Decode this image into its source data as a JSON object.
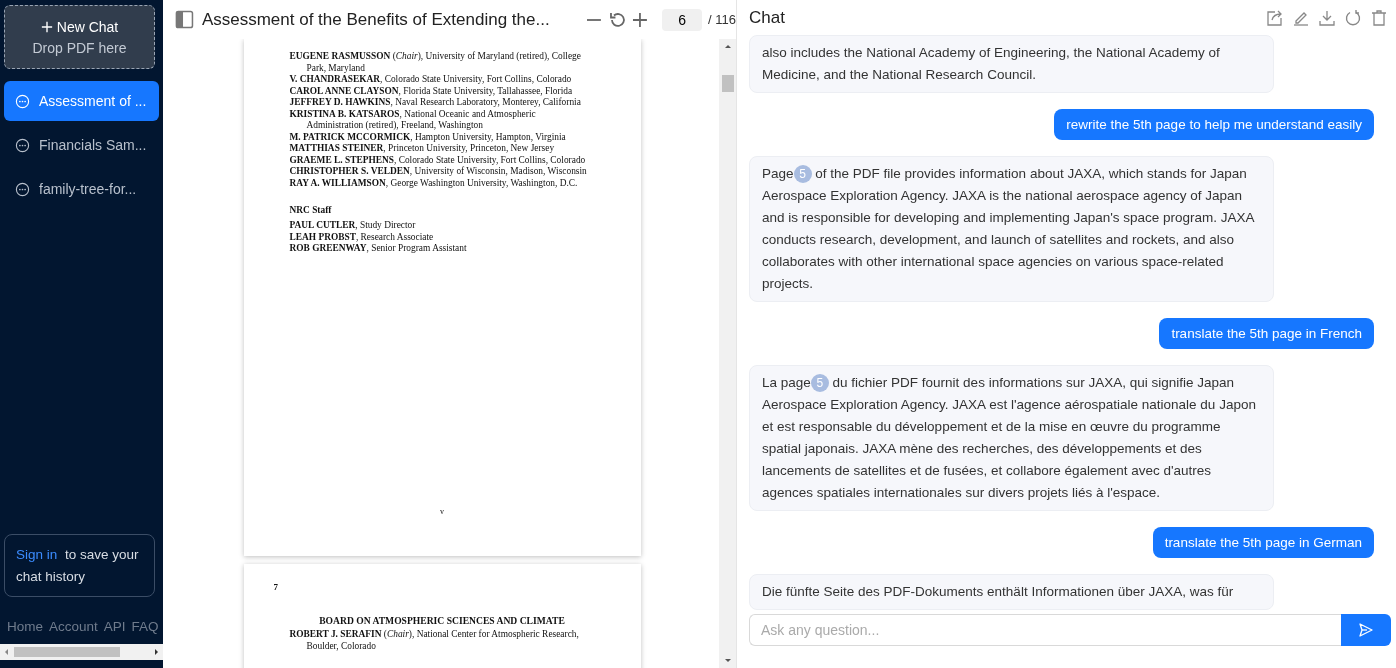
{
  "sidebar": {
    "new_chat": {
      "label": "New Chat",
      "hint": "Drop PDF here"
    },
    "items": [
      {
        "label": "Assessment of ...",
        "selected": true
      },
      {
        "label": "Financials Sam...",
        "selected": false
      },
      {
        "label": "family-tree-for...",
        "selected": false
      }
    ],
    "sign_in": {
      "link": "Sign in",
      "text": "to save your chat history"
    },
    "footer_links": [
      "Home",
      "Account",
      "API",
      "FAQ"
    ]
  },
  "viewer": {
    "title": "Assessment of the Benefits of Extending the...",
    "page": "6",
    "total": "/ 116",
    "pages": [
      {
        "lines": [
          {
            "text": "**EUGENE RASMUSSON** (*Chair*), University of Maryland (retired), College",
            "indent": false
          },
          {
            "text": "Park, Maryland",
            "indent": true
          },
          {
            "text": "**V. CHANDRASEKAR**, Colorado State University, Fort Collins, Colorado",
            "indent": false
          },
          {
            "text": "**CAROL ANNE CLAYSON**, Florida State University, Tallahassee, Florida",
            "indent": false
          },
          {
            "text": "**JEFFREY D. HAWKINS**, Naval Research Laboratory, Monterey, California",
            "indent": false
          },
          {
            "text": "**KRISTINA B. KATSAROS**, National Oceanic and Atmospheric",
            "indent": false
          },
          {
            "text": "Administration (retired), Freeland, Washington",
            "indent": true
          },
          {
            "text": "**M. PATRICK MCCORMICK**, Hampton University, Hampton, Virginia",
            "indent": false
          },
          {
            "text": "**MATTHIAS STEINER**, Princeton University, Princeton, New Jersey",
            "indent": false
          },
          {
            "text": "**GRAEME L. STEPHENS**, Colorado State University, Fort Collins, Colorado",
            "indent": false
          },
          {
            "text": "**CHRISTOPHER S. VELDEN**, University of Wisconsin, Madison, Wisconsin",
            "indent": false
          },
          {
            "text": "**RAY A. WILLIAMSON**, George Washington University, Washington, D.C.",
            "indent": false
          }
        ],
        "staff_heading": "NRC Staff",
        "staff": [
          {
            "text": "**PAUL CUTLER**, Study Director",
            "indent": false
          },
          {
            "text": "**LEAH PROBST**, Research Associate",
            "indent": false
          },
          {
            "text": "**ROB GREENWAY**, Senior Program Assistant",
            "indent": false
          }
        ],
        "folio": "v"
      },
      {
        "number": "7",
        "heading": "BOARD ON ATMOSPHERIC SCIENCES AND CLIMATE",
        "lines": [
          {
            "text": "**ROBERT J. SERAFIN** (*Chair*), National Center for Atmospheric Research,",
            "indent": false
          },
          {
            "text": "Boulder, Colorado",
            "indent": true
          }
        ]
      }
    ]
  },
  "chat": {
    "title": "Chat",
    "messages": [
      {
        "kind": "assistant",
        "before": "also includes the National Academy of Engineering, the National Academy of Medicine, and the National Research Council."
      },
      {
        "kind": "user",
        "text": "rewrite the 5th page to help me understand easily"
      },
      {
        "kind": "assistant",
        "before": "Page",
        "page": "5",
        "after": "of the PDF file provides information about JAXA, which stands for Japan Aerospace Exploration Agency. JAXA is the national aerospace agency of Japan and is responsible for developing and implementing Japan's space program. JAXA conducts research, development, and launch of satellites and rockets, and also collaborates with other international space agencies on various space-related projects."
      },
      {
        "kind": "user",
        "text": "translate the 5th page in French"
      },
      {
        "kind": "assistant",
        "before": "La page",
        "page": "5",
        "after": "du fichier PDF fournit des informations sur JAXA, qui signifie Japan Aerospace Exploration Agency. JAXA est l'agence aérospatiale nationale du Japon et est responsable du développement et de la mise en œuvre du programme spatial japonais. JAXA mène des recherches, des développements et des lancements de satellites et de fusées, et collabore également avec d'autres agences spatiales internationales sur divers projets liés à l'espace."
      },
      {
        "kind": "user",
        "text": "translate the 5th page in German"
      },
      {
        "kind": "assistant",
        "before": "Die fünfte Seite des PDF-Dokuments enthält Informationen über JAXA, was für"
      }
    ],
    "input": {
      "placeholder": "Ask any question..."
    }
  }
}
